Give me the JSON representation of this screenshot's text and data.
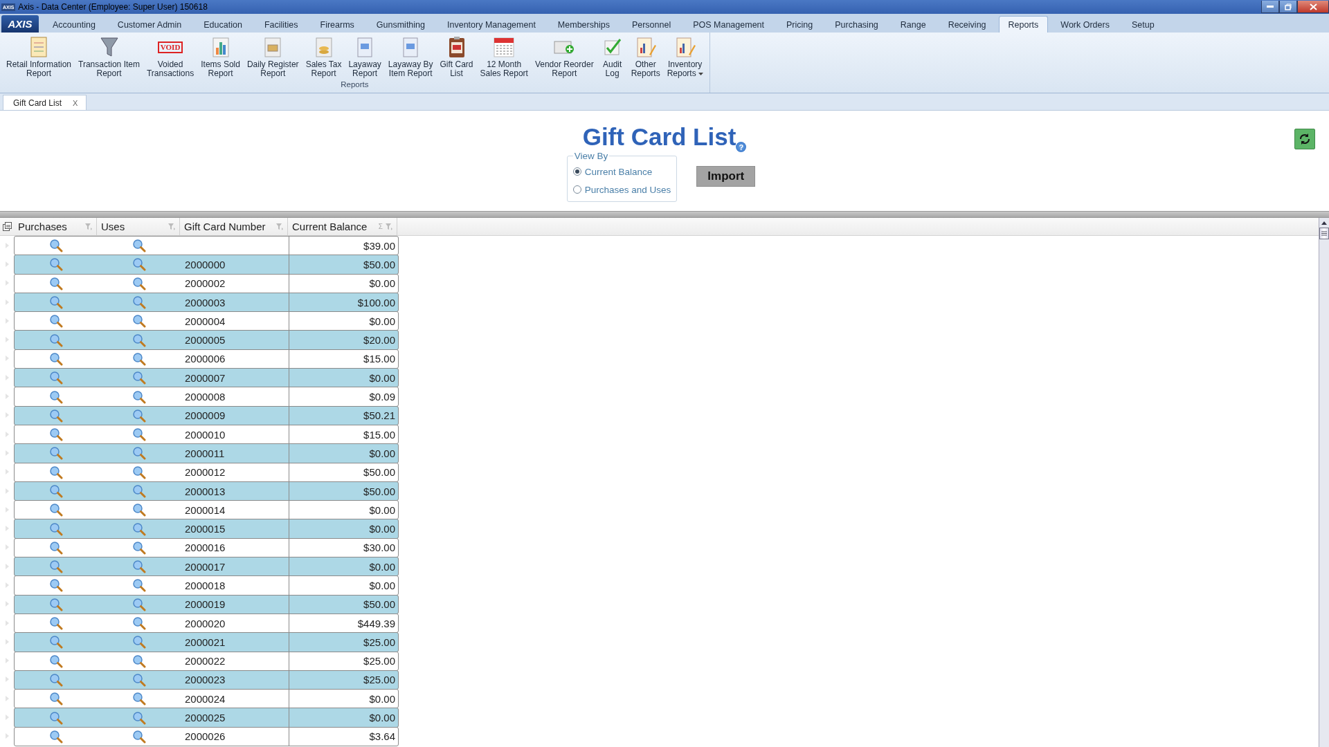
{
  "window": {
    "title": "Axis - Data Center  (Employee: Super User) 150618",
    "icon_text": "AXIS",
    "logo": "AXIS"
  },
  "menu_tabs": [
    {
      "label": "Accounting",
      "selected": false
    },
    {
      "label": "Customer Admin",
      "selected": false
    },
    {
      "label": "Education",
      "selected": false
    },
    {
      "label": "Facilities",
      "selected": false
    },
    {
      "label": "Firearms",
      "selected": false
    },
    {
      "label": "Gunsmithing",
      "selected": false
    },
    {
      "label": "Inventory Management",
      "selected": false
    },
    {
      "label": "Memberships",
      "selected": false
    },
    {
      "label": "Personnel",
      "selected": false
    },
    {
      "label": "POS Management",
      "selected": false
    },
    {
      "label": "Pricing",
      "selected": false
    },
    {
      "label": "Purchasing",
      "selected": false
    },
    {
      "label": "Range",
      "selected": false
    },
    {
      "label": "Receiving",
      "selected": false
    },
    {
      "label": "Reports",
      "selected": true
    },
    {
      "label": "Work Orders",
      "selected": false
    },
    {
      "label": "Setup",
      "selected": false
    }
  ],
  "ribbon": {
    "group_label": "Reports",
    "buttons": [
      {
        "label": "Retail Information\nReport",
        "kind": "doc"
      },
      {
        "label": "Transaction Item\nReport",
        "kind": "funnel"
      },
      {
        "label": "Voided\nTransactions",
        "kind": "void",
        "badge": "VOID"
      },
      {
        "label": "Items Sold\nReport",
        "kind": "chart"
      },
      {
        "label": "Daily Register\nReport",
        "kind": "register"
      },
      {
        "label": "Sales Tax\nReport",
        "kind": "coins"
      },
      {
        "label": "Layaway\nReport",
        "kind": "sheet"
      },
      {
        "label": "Layaway By\nItem Report",
        "kind": "sheet"
      },
      {
        "label": "Gift Card\nList",
        "kind": "gift"
      },
      {
        "label": "12 Month\nSales Report",
        "kind": "calendar"
      },
      {
        "label": "Vendor Reorder\nReport",
        "kind": "reorder"
      },
      {
        "label": "Audit\nLog",
        "kind": "check"
      },
      {
        "label": "Other\nReports",
        "kind": "chartdoc"
      },
      {
        "label": "Inventory\nReports",
        "kind": "chartdoc",
        "dropdown": true
      }
    ]
  },
  "doc_tab": {
    "label": "Gift Card List",
    "close": "X"
  },
  "page": {
    "title": "Gift Card List",
    "help": "?",
    "view_by": {
      "legend": "View By",
      "options": [
        {
          "label": "Current Balance",
          "selected": true
        },
        {
          "label": "Purchases and Uses",
          "selected": false
        }
      ]
    },
    "import_button": "Import"
  },
  "table": {
    "columns": [
      "Purchases",
      "Uses",
      "Gift Card Number",
      "Current Balance"
    ],
    "summary_mark": "Σ",
    "rows": [
      {
        "balance": "$39.00"
      },
      {
        "card_number": "2000000",
        "balance": "$50.00"
      },
      {
        "card_number": "2000002",
        "balance": "$0.00"
      },
      {
        "card_number": "2000003",
        "balance": "$100.00"
      },
      {
        "card_number": "2000004",
        "balance": "$0.00"
      },
      {
        "card_number": "2000005",
        "balance": "$20.00"
      },
      {
        "card_number": "2000006",
        "balance": "$15.00"
      },
      {
        "card_number": "2000007",
        "balance": "$0.00"
      },
      {
        "card_number": "2000008",
        "balance": "$0.09"
      },
      {
        "card_number": "2000009",
        "balance": "$50.21"
      },
      {
        "card_number": "2000010",
        "balance": "$15.00"
      },
      {
        "card_number": "2000011",
        "balance": "$0.00"
      },
      {
        "card_number": "2000012",
        "balance": "$50.00"
      },
      {
        "card_number": "2000013",
        "balance": "$50.00"
      },
      {
        "card_number": "2000014",
        "balance": "$0.00"
      },
      {
        "card_number": "2000015",
        "balance": "$0.00"
      },
      {
        "card_number": "2000016",
        "balance": "$30.00"
      },
      {
        "card_number": "2000017",
        "balance": "$0.00"
      },
      {
        "card_number": "2000018",
        "balance": "$0.00"
      },
      {
        "card_number": "2000019",
        "balance": "$50.00"
      },
      {
        "card_number": "2000020",
        "balance": "$449.39"
      },
      {
        "card_number": "2000021",
        "balance": "$25.00"
      },
      {
        "card_number": "2000022",
        "balance": "$25.00"
      },
      {
        "card_number": "2000023",
        "balance": "$25.00"
      },
      {
        "card_number": "2000024",
        "balance": "$0.00"
      },
      {
        "card_number": "2000025",
        "balance": "$0.00"
      },
      {
        "card_number": "2000026",
        "balance": "$3.64"
      }
    ]
  }
}
